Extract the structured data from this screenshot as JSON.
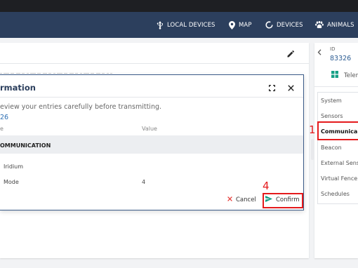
{
  "nav": {
    "items": [
      {
        "label": "LOCAL DEVICES",
        "icon": "usb-icon"
      },
      {
        "label": "MAP",
        "icon": "map-pin-icon"
      },
      {
        "label": "DEVICES",
        "icon": "ring-icon"
      },
      {
        "label": "ANIMALS",
        "icon": "paw-icon"
      }
    ]
  },
  "right_panel": {
    "id_label": "ID",
    "id_value": "83326",
    "telemetry_label": "Telen",
    "menu": [
      "System",
      "Sensors",
      "Communica",
      "Beacon",
      "External Sens",
      "Virtual Fence",
      "Schedules"
    ],
    "active_index": 2
  },
  "modal": {
    "title": "rmation",
    "instruction": "eview your entries carefully before transmitting.",
    "device_id": "26",
    "col_name": "e",
    "col_value": "Value",
    "section": "OMMUNICATION",
    "rows": [
      {
        "label": "Iridium",
        "value": ""
      },
      {
        "label": "Mode",
        "value": "4"
      }
    ],
    "cancel_label": "Cancel",
    "confirm_label": "Confirm"
  },
  "annotations": {
    "communication_number": "1",
    "confirm_number": "4",
    "color": "#e41a1c"
  },
  "colors": {
    "navbar": "#2c3f5d",
    "accent": "#2d6fb3",
    "confirm_icon": "#16a085",
    "cancel_icon": "#e53935"
  }
}
